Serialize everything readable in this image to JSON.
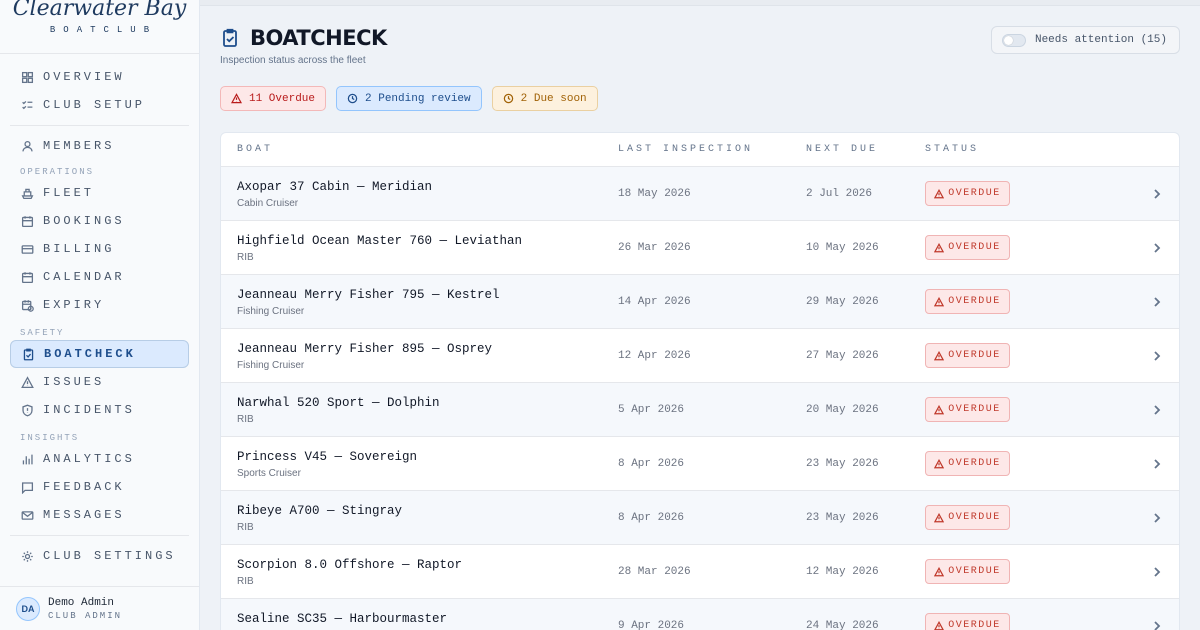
{
  "brand": {
    "name": "Clearwater Bay",
    "sub": "BOATCLUB"
  },
  "nav": {
    "overview": "OVERVIEW",
    "club_setup": "CLUB SETUP",
    "members": "MEMBERS",
    "section_operations": "OPERATIONS",
    "fleet": "FLEET",
    "bookings": "BOOKINGS",
    "billing": "BILLING",
    "calendar": "CALENDAR",
    "expiry": "EXPIRY",
    "section_safety": "SAFETY",
    "boatcheck": "BOATCHECK",
    "issues": "ISSUES",
    "incidents": "INCIDENTS",
    "section_insights": "INSIGHTS",
    "analytics": "ANALYTICS",
    "feedback": "FEEDBACK",
    "messages": "MESSAGES",
    "club_settings": "CLUB SETTINGS"
  },
  "user": {
    "initials": "DA",
    "name": "Demo Admin",
    "role": "CLUB ADMIN"
  },
  "page": {
    "title": "BOATCHECK",
    "subtitle": "Inspection status across the fleet",
    "attention_label": "Needs attention (15)"
  },
  "chips": {
    "overdue": "11 Overdue",
    "pending": "2 Pending review",
    "due_soon": "2 Due soon"
  },
  "table": {
    "headers": {
      "boat": "BOAT",
      "last": "LAST INSPECTION",
      "next": "NEXT DUE",
      "status": "STATUS"
    },
    "rows": [
      {
        "name": "Axopar 37 Cabin — Meridian",
        "type": "Cabin Cruiser",
        "last": "18 May 2026",
        "next": "2 Jul 2026",
        "status": "OVERDUE"
      },
      {
        "name": "Highfield Ocean Master 760 — Leviathan",
        "type": "RIB",
        "last": "26 Mar 2026",
        "next": "10 May 2026",
        "status": "OVERDUE"
      },
      {
        "name": "Jeanneau Merry Fisher 795 — Kestrel",
        "type": "Fishing Cruiser",
        "last": "14 Apr 2026",
        "next": "29 May 2026",
        "status": "OVERDUE"
      },
      {
        "name": "Jeanneau Merry Fisher 895 — Osprey",
        "type": "Fishing Cruiser",
        "last": "12 Apr 2026",
        "next": "27 May 2026",
        "status": "OVERDUE"
      },
      {
        "name": "Narwhal 520 Sport — Dolphin",
        "type": "RIB",
        "last": "5 Apr 2026",
        "next": "20 May 2026",
        "status": "OVERDUE"
      },
      {
        "name": "Princess V45 — Sovereign",
        "type": "Sports Cruiser",
        "last": "8 Apr 2026",
        "next": "23 May 2026",
        "status": "OVERDUE"
      },
      {
        "name": "Ribeye A700 — Stingray",
        "type": "RIB",
        "last": "8 Apr 2026",
        "next": "23 May 2026",
        "status": "OVERDUE"
      },
      {
        "name": "Scorpion 8.0 Offshore — Raptor",
        "type": "RIB",
        "last": "28 Mar 2026",
        "next": "12 May 2026",
        "status": "OVERDUE"
      },
      {
        "name": "Sealine SC35 — Harbourmaster",
        "type": "",
        "last": "9 Apr 2026",
        "next": "24 May 2026",
        "status": "OVERDUE"
      }
    ]
  },
  "colors": {
    "accent": "#1e4e8c",
    "overdue": "#c0392b",
    "pending": "#1e4e8c",
    "due_soon": "#a16207"
  }
}
